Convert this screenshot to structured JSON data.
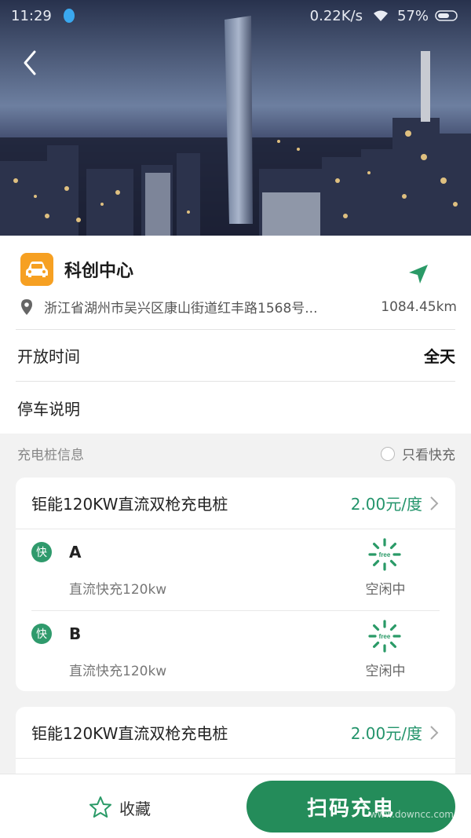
{
  "status_bar": {
    "time": "11:29",
    "speed": "0.22K/s",
    "battery": "57%"
  },
  "station": {
    "name": "科创中心",
    "address": "浙江省湖州市吴兴区康山街道红丰路1568号...",
    "distance": "1084.45km",
    "rows": [
      {
        "label": "开放时间",
        "value": "全天"
      },
      {
        "label": "停车说明",
        "value": ""
      }
    ]
  },
  "charger_section": {
    "title": "充电桩信息",
    "fast_only_label": "只看快充"
  },
  "piles": [
    {
      "name": "钜能120KW直流双枪充电桩",
      "price": "2.00元/度",
      "guns": [
        {
          "badge": "快",
          "name": "A",
          "desc": "直流快充120kw",
          "status": "空闲中",
          "status_icon_text": "free"
        },
        {
          "badge": "快",
          "name": "B",
          "desc": "直流快充120kw",
          "status": "空闲中",
          "status_icon_text": "free"
        }
      ]
    },
    {
      "name": "钜能120KW直流双枪充电桩",
      "price": "2.00元/度",
      "guns": []
    }
  ],
  "bottom_bar": {
    "favorite_label": "收藏",
    "scan_label": "扫码充电",
    "watermark": "www.downcc.com"
  },
  "colors": {
    "accent_green": "#23946b",
    "button_green": "#248c5a",
    "badge_orange": "#f6a022"
  },
  "icons": [
    "back-arrow-icon",
    "car-icon",
    "navigation-arrow-icon",
    "location-pin-icon",
    "chevron-right-icon",
    "free-status-icon",
    "star-icon",
    "wifi-icon",
    "battery-icon"
  ]
}
